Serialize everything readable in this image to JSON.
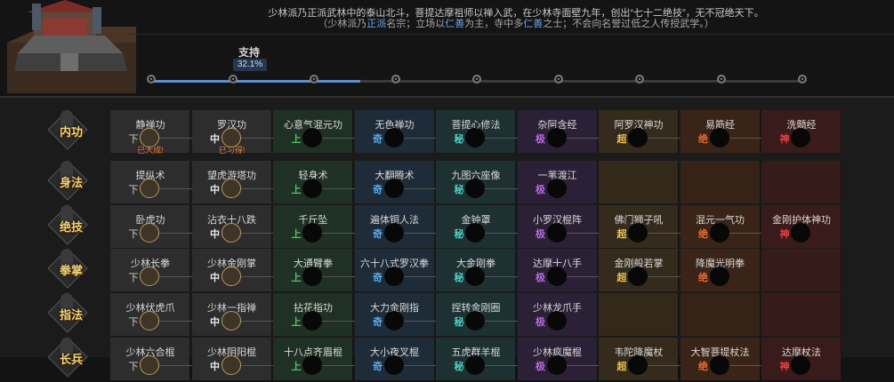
{
  "header": {
    "description_line1": "少林派乃正派武林中的泰山北斗，菩提达摩祖师以禅入武，在少林寺面壁九年，创出“七十二绝技”，无不冠绝天下。",
    "description_line2_parts": [
      "（少林派乃",
      "正派",
      "名宗；立场以",
      "仁善",
      "为主，寺中多",
      "仁善",
      "之士；不会向名誉过低之人传授武学。）"
    ],
    "support_label": "支持",
    "support_value": "32.1%",
    "support_progress": 0.321,
    "track_nodes": 9
  },
  "tier_labels": [
    "下",
    "中",
    "上",
    "奇",
    "秘",
    "极",
    "超",
    "绝",
    "神"
  ],
  "rows": [
    {
      "label": "内功",
      "skills": [
        {
          "name": "静禅功",
          "status": "已大成!"
        },
        {
          "name": "罗汉功",
          "status": "已习得!"
        },
        {
          "name": "心意气混元功",
          "status": ""
        },
        {
          "name": "无色禅功",
          "status": ""
        },
        {
          "name": "菩提心修法",
          "status": ""
        },
        {
          "name": "杂阿含经",
          "status": ""
        },
        {
          "name": "阿罗汉神功",
          "status": ""
        },
        {
          "name": "易筋经",
          "status": ""
        },
        {
          "name": "洗髓经",
          "status": ""
        }
      ]
    },
    {
      "label": "身法",
      "skills": [
        {
          "name": "提纵术",
          "status": ""
        },
        {
          "name": "望虎游塔功",
          "status": ""
        },
        {
          "name": "轻身术",
          "status": ""
        },
        {
          "name": "大翻腾术",
          "status": ""
        },
        {
          "name": "九图六座像",
          "status": ""
        },
        {
          "name": "一苇渡江",
          "status": ""
        }
      ]
    },
    {
      "label": "绝技",
      "skills": [
        {
          "name": "卧虎功",
          "status": ""
        },
        {
          "name": "沾衣十八跌",
          "status": ""
        },
        {
          "name": "千斤坠",
          "status": ""
        },
        {
          "name": "遍体铜人法",
          "status": ""
        },
        {
          "name": "金钟罩",
          "status": ""
        },
        {
          "name": "小罗汉棍阵",
          "status": ""
        },
        {
          "name": "佛门狮子吼",
          "status": ""
        },
        {
          "name": "混元一气功",
          "status": ""
        },
        {
          "name": "金刚护体神功",
          "status": ""
        }
      ]
    },
    {
      "label": "拳掌",
      "skills": [
        {
          "name": "少林长拳",
          "status": ""
        },
        {
          "name": "少林金刚掌",
          "status": ""
        },
        {
          "name": "大通臂拳",
          "status": ""
        },
        {
          "name": "六十八式罗汉拳",
          "status": ""
        },
        {
          "name": "大金刚拳",
          "status": ""
        },
        {
          "name": "达摩十八手",
          "status": ""
        },
        {
          "name": "金刚般若掌",
          "status": ""
        },
        {
          "name": "降魔光明拳",
          "status": ""
        }
      ]
    },
    {
      "label": "指法",
      "skills": [
        {
          "name": "少林伏虎爪",
          "status": ""
        },
        {
          "name": "少林一指禅",
          "status": ""
        },
        {
          "name": "拈花指功",
          "status": ""
        },
        {
          "name": "大力金刚指",
          "status": ""
        },
        {
          "name": "捏转金刚圈",
          "status": ""
        },
        {
          "name": "少林龙爪手",
          "status": ""
        }
      ]
    },
    {
      "label": "长兵",
      "skills": [
        {
          "name": "少林六合棍",
          "status": ""
        },
        {
          "name": "少林阴阳棍",
          "status": ""
        },
        {
          "name": "十八点齐眉棍",
          "status": ""
        },
        {
          "name": "大小夜叉棍",
          "status": ""
        },
        {
          "name": "五虎群羊棍",
          "status": ""
        },
        {
          "name": "少林疯魔棍",
          "status": ""
        },
        {
          "name": "韦陀降魔杖",
          "status": ""
        },
        {
          "name": "大智菩提杖法",
          "status": ""
        },
        {
          "name": "达摩杖法",
          "status": ""
        }
      ]
    }
  ],
  "colors": {
    "accent_blue": "#5e8fc8",
    "learned_text": "#f07a3a",
    "row_label": "#f2d27a"
  }
}
